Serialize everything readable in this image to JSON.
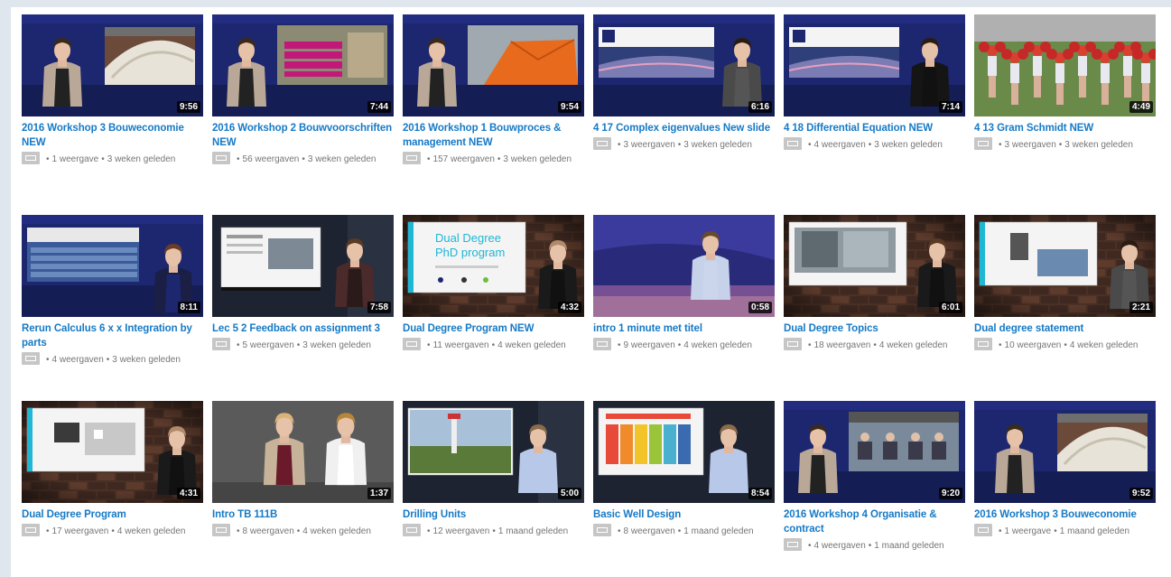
{
  "videos": [
    {
      "title": "2016 Workshop 3 Bouweconomie NEW",
      "duration": "9:56",
      "views": "1 weergave",
      "age": "3 weken geleden",
      "scene": "arch"
    },
    {
      "title": "2016 Workshop 2 Bouwvoorschriften NEW",
      "duration": "7:44",
      "views": "56 weergaven",
      "age": "3 weken geleden",
      "scene": "pink"
    },
    {
      "title": "2016 Workshop 1 Bouwproces & management NEW",
      "duration": "9:54",
      "views": "157 weergaven",
      "age": "3 weken geleden",
      "scene": "orange"
    },
    {
      "title": "4 17 Complex eigenvalues New slide",
      "duration": "6:16",
      "views": "3 weergaven",
      "age": "3 weken geleden",
      "scene": "math"
    },
    {
      "title": "4 18 Differential Equation NEW",
      "duration": "7:14",
      "views": "4 weergaven",
      "age": "3 weken geleden",
      "scene": "math2"
    },
    {
      "title": "4 13 Gram Schmidt NEW",
      "duration": "4:49",
      "views": "3 weergaven",
      "age": "3 weken geleden",
      "scene": "cheer"
    },
    {
      "title": "Rerun Calculus 6 x x Integration by parts",
      "duration": "8:11",
      "views": "4 weergaven",
      "age": "3 weken geleden",
      "scene": "solar"
    },
    {
      "title": "Lec 5 2 Feedback on assignment 3",
      "duration": "7:58",
      "views": "5 weergaven",
      "age": "3 weken geleden",
      "scene": "lec"
    },
    {
      "title": "Dual Degree Program NEW",
      "duration": "4:32",
      "views": "11 weergaven",
      "age": "4 weken geleden",
      "scene": "phd",
      "slide1": "Dual Degree",
      "slide2": "PhD program"
    },
    {
      "title": "intro 1 minute met titel",
      "duration": "0:58",
      "views": "9 weergaven",
      "age": "4 weken geleden",
      "scene": "intro"
    },
    {
      "title": "Dual Degree Topics",
      "duration": "6:01",
      "views": "18 weergaven",
      "age": "4 weken geleden",
      "scene": "topics"
    },
    {
      "title": "Dual degree statement",
      "duration": "2:21",
      "views": "10 weergaven",
      "age": "4 weken geleden",
      "scene": "stmt"
    },
    {
      "title": "Dual Degree Program",
      "duration": "4:31",
      "views": "17 weergaven",
      "age": "4 weken geleden",
      "scene": "prog"
    },
    {
      "title": "Intro TB 111B",
      "duration": "1:37",
      "views": "8 weergaven",
      "age": "4 weken geleden",
      "scene": "two"
    },
    {
      "title": "Drilling Units",
      "duration": "5:00",
      "views": "12 weergaven",
      "age": "1 maand geleden",
      "scene": "drill"
    },
    {
      "title": "Basic Well Design",
      "duration": "8:54",
      "views": "8 weergaven",
      "age": "1 maand geleden",
      "scene": "well"
    },
    {
      "title": "2016 Workshop 4 Organisatie & contract",
      "duration": "9:20",
      "views": "4 weergaven",
      "age": "1 maand geleden",
      "scene": "panel"
    },
    {
      "title": "2016 Workshop 3 Bouweconomie",
      "duration": "9:52",
      "views": "1 weergave",
      "age": "1 maand geleden",
      "scene": "arch"
    }
  ],
  "separator": "•",
  "colors": {
    "title": "#167ac6",
    "studio": "#1c2770",
    "accent_cyan": "#1fb7d4"
  }
}
